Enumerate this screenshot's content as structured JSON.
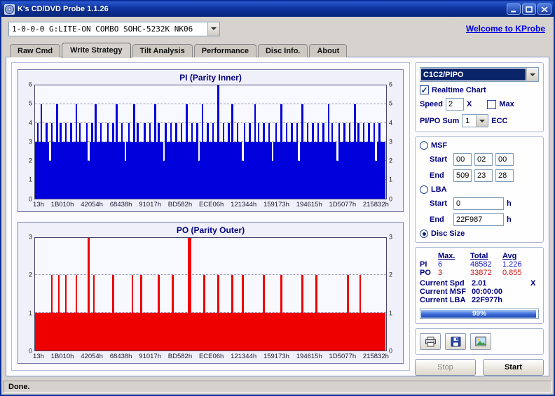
{
  "window": {
    "title": "K's CD/DVD Probe 1.1.26",
    "status": "Done."
  },
  "header": {
    "drive": "1-0-0-0 G:LITE-ON COMBO SOHC-5232K NK06",
    "welcome_link": "Welcome to KProbe"
  },
  "tabs": {
    "items": [
      "Raw Cmd",
      "Write Strategy",
      "Tilt Analysis",
      "Performance",
      "Disc Info.",
      "About"
    ],
    "active_index": 1
  },
  "panel": {
    "mode_select": "C1C2/PIPO",
    "realtime_label": "Realtime Chart",
    "realtime_checked": true,
    "speed_label": "Speed",
    "speed_value": "2",
    "speed_unit": "X",
    "max_label": "Max",
    "max_checked": false,
    "pipo_sum_label": "PI/PO Sum",
    "pipo_sum_value": "1",
    "ecc_label": "ECC",
    "msf": {
      "label": "MSF",
      "selected": false,
      "start_label": "Start",
      "end_label": "End",
      "start": [
        "00",
        "02",
        "00"
      ],
      "end": [
        "509",
        "23",
        "28"
      ]
    },
    "lba": {
      "label": "LBA",
      "selected": false,
      "start_label": "Start",
      "end_label": "End",
      "start": "0",
      "end": "22F987",
      "unit": "h"
    },
    "disc_size": {
      "label": "Disc Size",
      "selected": true
    },
    "stats": {
      "headers": [
        "Max.",
        "Total",
        "Avg"
      ],
      "rows": [
        {
          "label": "PI",
          "max": "6",
          "total": "48582",
          "avg": "1.226",
          "color": "#1414cc"
        },
        {
          "label": "PO",
          "max": "3",
          "total": "33872",
          "avg": "0.855",
          "color": "#cc1414"
        }
      ]
    },
    "current": [
      {
        "label": "Current Spd",
        "value": "2.01",
        "suffix": "X"
      },
      {
        "label": "Current MSF",
        "value": "00:00:00",
        "suffix": ""
      },
      {
        "label": "Current LBA",
        "value": "22F977h",
        "suffix": ""
      }
    ],
    "progress": {
      "percent": 99,
      "label": "99%"
    },
    "stop_label": "Stop",
    "start_label": "Start"
  },
  "chart_data": [
    {
      "type": "bar",
      "title": "PI (Parity Inner)",
      "ylim": [
        0,
        6
      ],
      "yticks": [
        0,
        1,
        2,
        3,
        4,
        5,
        6
      ],
      "grid": "dashed-horizontal",
      "color": "#0000dd",
      "x_tick_labels": [
        "13h",
        "1B010h",
        "42054h",
        "68438h",
        "91017h",
        "BD582h",
        "ECE06h",
        "121344h",
        "159173h",
        "194615h",
        "1D5077h",
        "215832h"
      ],
      "values": [
        3,
        4,
        3,
        5,
        3,
        3,
        4,
        3,
        2,
        4,
        3,
        3,
        5,
        3,
        4,
        3,
        3,
        4,
        3,
        3,
        4,
        3,
        3,
        5,
        3,
        4,
        3,
        3,
        3,
        4,
        2,
        3,
        4,
        3,
        5,
        3,
        3,
        4,
        3,
        3,
        3,
        4,
        3,
        3,
        4,
        3,
        5,
        3,
        3,
        4,
        3,
        2,
        3,
        4,
        3,
        3,
        5,
        3,
        4,
        3,
        3,
        3,
        4,
        3,
        3,
        4,
        3,
        3,
        5,
        3,
        4,
        3,
        3,
        2,
        4,
        3,
        3,
        4,
        3,
        3,
        4,
        3,
        3,
        4,
        3,
        3,
        5,
        3,
        3,
        4,
        3,
        3,
        4,
        2,
        3,
        5,
        3,
        3,
        4,
        3,
        3,
        4,
        3,
        3,
        6,
        3,
        3,
        4,
        3,
        3,
        4,
        3,
        5,
        3,
        3,
        4,
        3,
        3,
        2,
        4,
        3,
        3,
        4,
        3,
        3,
        5,
        3,
        4,
        3,
        3,
        4,
        3,
        3,
        4,
        3,
        2,
        3,
        4,
        3,
        3,
        5,
        3,
        3,
        4,
        3,
        3,
        4,
        3,
        3,
        4,
        2,
        3,
        5,
        3,
        3,
        4,
        3,
        3,
        4,
        3,
        3,
        4,
        3,
        3,
        4,
        3,
        3,
        5,
        3,
        4,
        3,
        3,
        2,
        4,
        3,
        3,
        4,
        3,
        3,
        4,
        3,
        3,
        5,
        3,
        4,
        3,
        3,
        4,
        3,
        3,
        4,
        3,
        3,
        4,
        2,
        3,
        4,
        3,
        3,
        3
      ]
    },
    {
      "type": "bar",
      "title": "PO (Parity Outer)",
      "ylim": [
        0,
        3
      ],
      "yticks": [
        0,
        1,
        2,
        3
      ],
      "grid": "dashed-horizontal",
      "color": "#ee0000",
      "x_tick_labels": [
        "13h",
        "1B010h",
        "42054h",
        "68438h",
        "91017h",
        "BD582h",
        "ECE06h",
        "121344h",
        "159173h",
        "194615h",
        "1D5077h",
        "215832h"
      ],
      "values": [
        1,
        1,
        1,
        1,
        1,
        1,
        1,
        1,
        1,
        2,
        1,
        1,
        1,
        2,
        1,
        1,
        1,
        2,
        1,
        1,
        1,
        1,
        1,
        2,
        1,
        1,
        1,
        1,
        1,
        1,
        3,
        1,
        1,
        2,
        1,
        1,
        1,
        1,
        1,
        1,
        1,
        1,
        1,
        1,
        2,
        1,
        1,
        1,
        1,
        1,
        1,
        1,
        1,
        1,
        1,
        2,
        1,
        1,
        1,
        1,
        2,
        1,
        1,
        1,
        1,
        1,
        1,
        1,
        1,
        1,
        2,
        1,
        1,
        1,
        1,
        1,
        1,
        1,
        2,
        1,
        1,
        1,
        1,
        1,
        1,
        1,
        1,
        3,
        3,
        1,
        1,
        1,
        1,
        1,
        1,
        1,
        2,
        1,
        1,
        1,
        1,
        1,
        1,
        1,
        2,
        1,
        1,
        1,
        1,
        1,
        1,
        1,
        2,
        1,
        1,
        1,
        1,
        1,
        2,
        1,
        1,
        1,
        1,
        1,
        1,
        1,
        1,
        1,
        1,
        1,
        2,
        1,
        1,
        1,
        1,
        1,
        1,
        1,
        1,
        1,
        2,
        1,
        1,
        1,
        1,
        1,
        1,
        1,
        1,
        1,
        1,
        1,
        2,
        1,
        1,
        1,
        1,
        1,
        1,
        1,
        2,
        1,
        1,
        1,
        1,
        1,
        1,
        1,
        1,
        1,
        1,
        1,
        1,
        1,
        1,
        1,
        1,
        1,
        2,
        1,
        1,
        1,
        1,
        1,
        1,
        2,
        1,
        1,
        1,
        1,
        1,
        1,
        1,
        1,
        1,
        1,
        1,
        1,
        1,
        1
      ]
    }
  ]
}
